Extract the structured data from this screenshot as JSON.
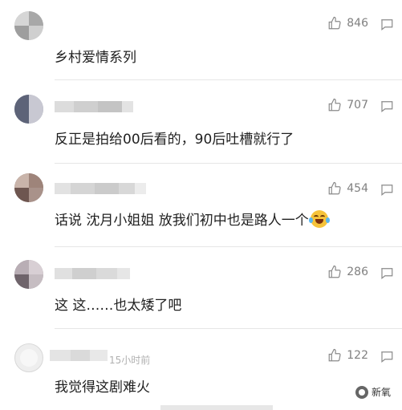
{
  "icons": {
    "like": "thumbs-up-icon",
    "reply": "comment-icon"
  },
  "comments": [
    {
      "likes": "846",
      "text": "乡村爱情系列"
    },
    {
      "likes": "707",
      "text": "反正是拍给00后看的，90后吐槽就行了"
    },
    {
      "likes": "454",
      "text": "话说 沈月小姐姐 放我们初中也是路人一个"
    },
    {
      "likes": "286",
      "text": "这 这……也太矮了吧"
    },
    {
      "likes": "122",
      "text": "我觉得这剧难火",
      "time": "15小时前"
    }
  ],
  "watermark": {
    "label": "新氧"
  },
  "colors": {
    "muted": "#808080",
    "divider": "#e6e6e6",
    "text": "#1f1f1f"
  }
}
